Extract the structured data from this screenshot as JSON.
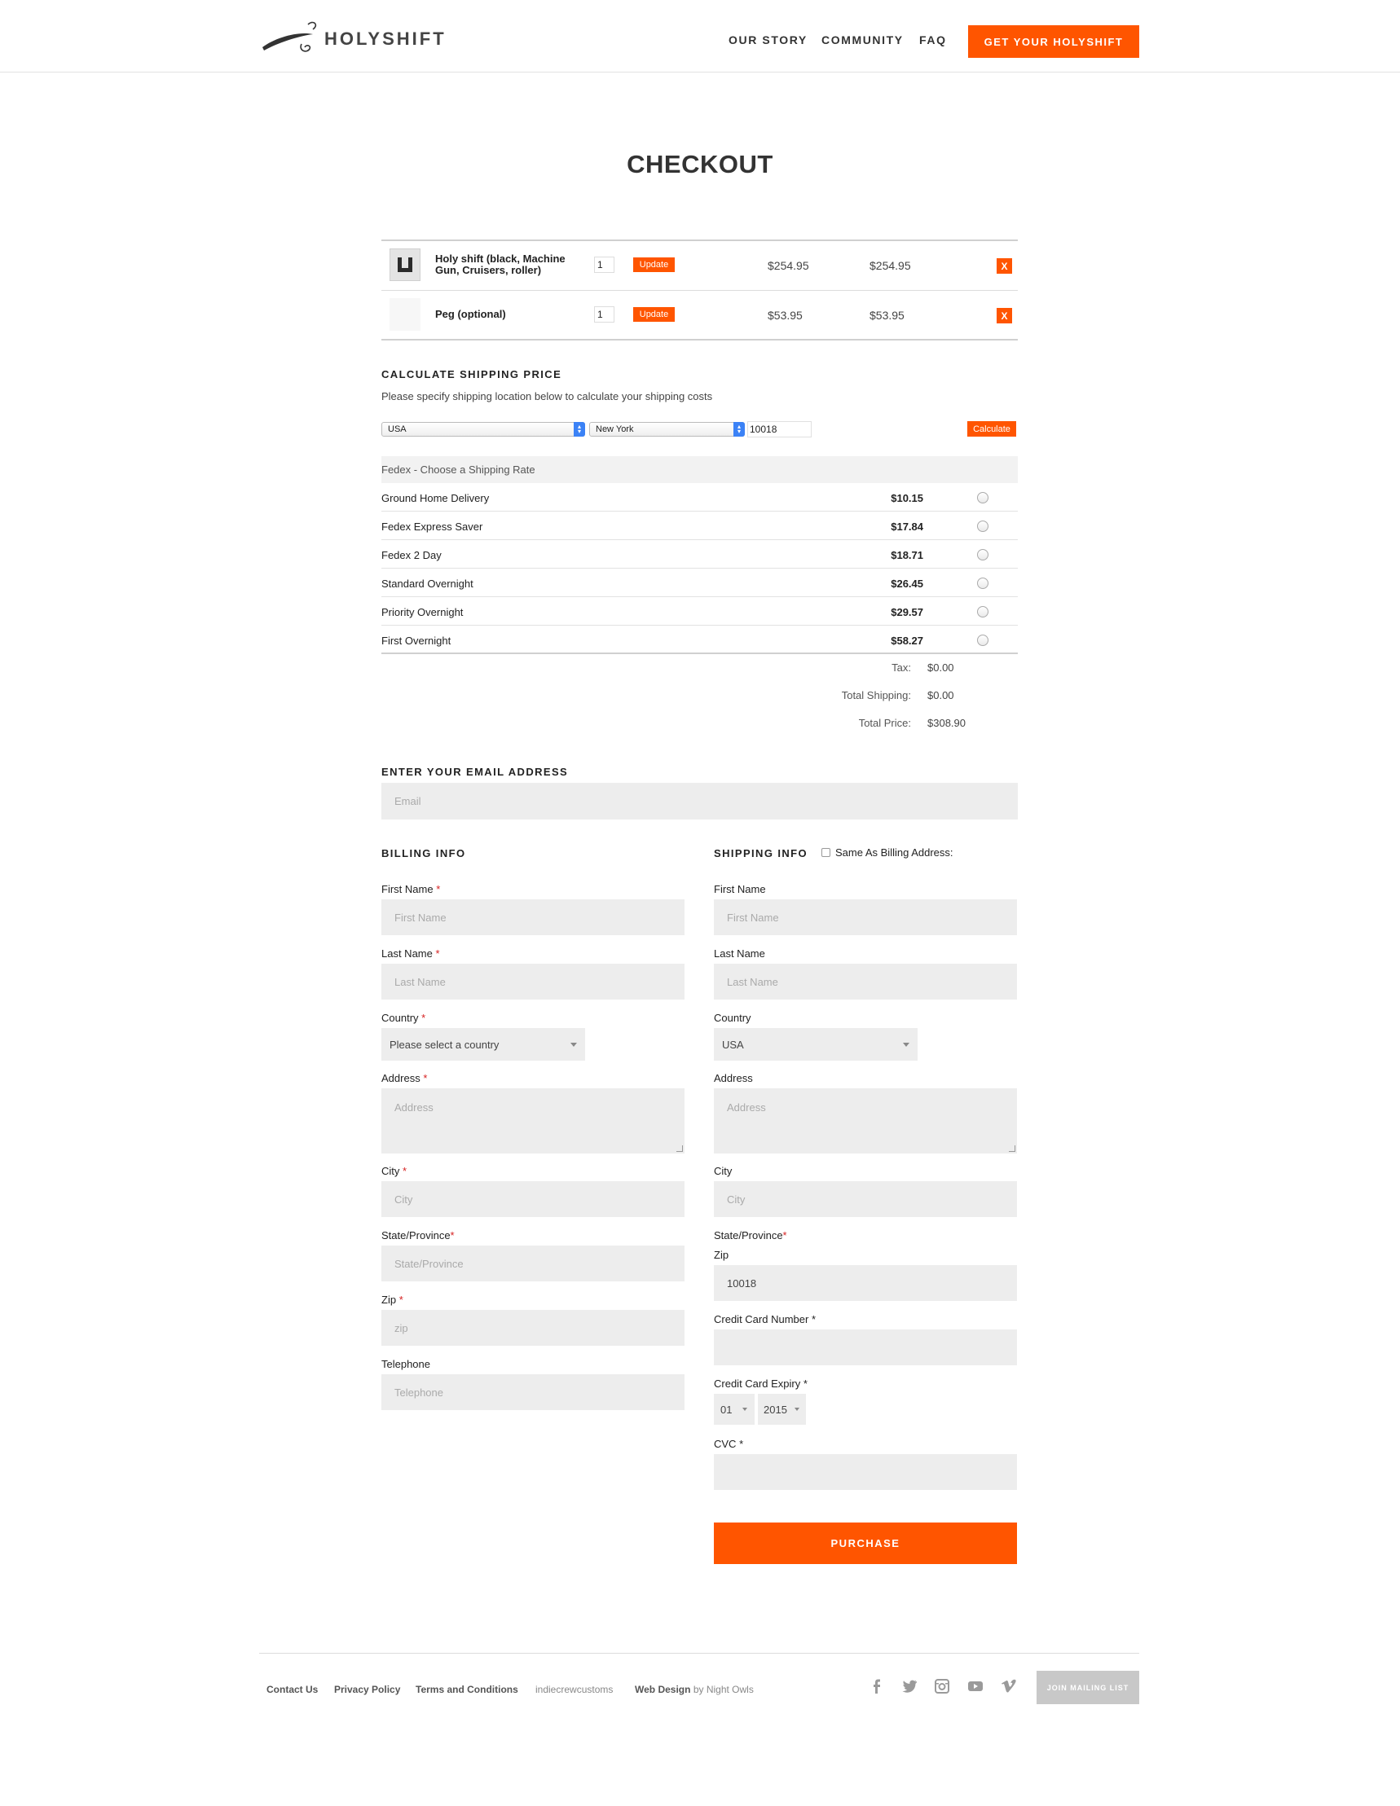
{
  "header": {
    "logo_text": "HOLYSHIFT",
    "nav": [
      "OUR STORY",
      "COMMUNITY",
      "FAQ"
    ],
    "cta": "GET YOUR HOLYSHIFT"
  },
  "page_title": "CHECKOUT",
  "cart": {
    "items": [
      {
        "name": "Holy shift (black, Machine Gun, Cruisers, roller)",
        "qty": "1",
        "update_label": "Update",
        "unit_price": "$254.95",
        "total_price": "$254.95",
        "remove_label": "X"
      },
      {
        "name": "Peg (optional)",
        "qty": "1",
        "update_label": "Update",
        "unit_price": "$53.95",
        "total_price": "$53.95",
        "remove_label": "X"
      }
    ]
  },
  "shipping_calc": {
    "heading": "CALCULATE SHIPPING PRICE",
    "help": "Please specify shipping location below to calculate your shipping costs",
    "country": "USA",
    "state": "New York",
    "zip": "10018",
    "calculate_label": "Calculate",
    "rate_header": "Fedex - Choose a Shipping Rate",
    "rates": [
      {
        "name": "Ground Home Delivery",
        "price": "$10.15"
      },
      {
        "name": "Fedex Express Saver",
        "price": "$17.84"
      },
      {
        "name": "Fedex 2 Day",
        "price": "$18.71"
      },
      {
        "name": "Standard Overnight",
        "price": "$26.45"
      },
      {
        "name": "Priority Overnight",
        "price": "$29.57"
      },
      {
        "name": "First Overnight",
        "price": "$58.27"
      }
    ]
  },
  "totals": {
    "tax_label": "Tax:",
    "tax": "$0.00",
    "shipping_label": "Total Shipping:",
    "shipping": "$0.00",
    "price_label": "Total Price:",
    "price": "$308.90"
  },
  "email": {
    "heading": "ENTER YOUR EMAIL ADDRESS",
    "placeholder": "Email"
  },
  "billing": {
    "heading": "BILLING INFO",
    "first_name_label": "First Name",
    "first_name_placeholder": "First Name",
    "last_name_label": "Last Name",
    "last_name_placeholder": "Last Name",
    "country_label": "Country",
    "country_value": "Please select a country",
    "address_label": "Address",
    "address_placeholder": "Address",
    "city_label": "City",
    "city_placeholder": "City",
    "state_label": "State/Province",
    "state_placeholder": "State/Province",
    "zip_label": "Zip",
    "zip_placeholder": "zip",
    "phone_label": "Telephone",
    "phone_placeholder": "Telephone"
  },
  "shipping": {
    "heading": "SHIPPING INFO",
    "same_as_billing": "Same As Billing Address:",
    "first_name_label": "First Name",
    "first_name_placeholder": "First Name",
    "last_name_label": "Last Name",
    "last_name_placeholder": "Last Name",
    "country_label": "Country",
    "country_value": "USA",
    "address_label": "Address",
    "address_placeholder": "Address",
    "city_label": "City",
    "city_placeholder": "City",
    "state_label": "State/Province",
    "zip_label": "Zip",
    "zip_value": "10018",
    "cc_label": "Credit Card Number",
    "expiry_label": "Credit Card Expiry",
    "expiry_month": "01",
    "expiry_year": "2015",
    "cvc_label": "CVC",
    "purchase_label": "PURCHASE"
  },
  "footer": {
    "links": [
      "Contact Us",
      "Privacy Policy",
      "Terms and Conditions"
    ],
    "credit_site": "indiecrewcustoms",
    "web_design_label": "Web Design",
    "by_label": "by Night Owls",
    "join_label": "JOIN MAILING LIST"
  },
  "colors": {
    "accent": "#ff5500",
    "field_bg": "#ededed",
    "required": "#d62222"
  }
}
